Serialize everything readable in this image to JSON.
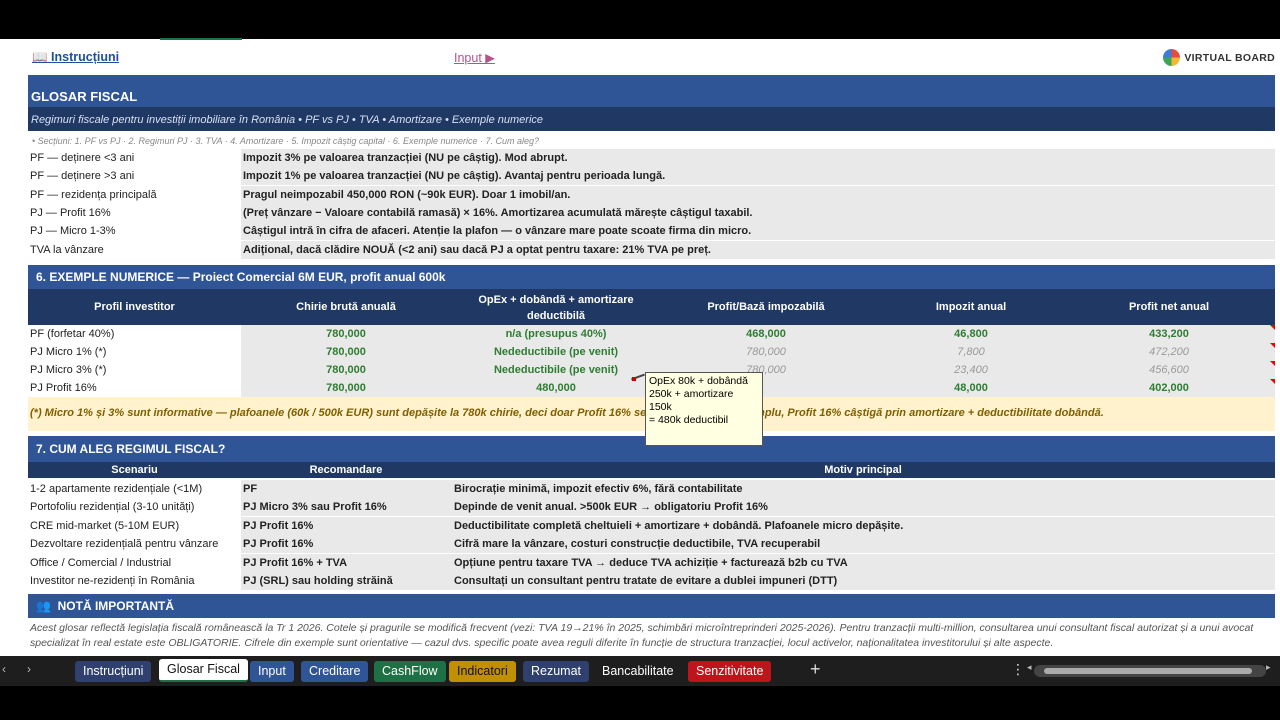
{
  "top": {
    "instructiuni_link": "Instrucțiuni",
    "input_link": "Input ▶",
    "logo_text": "VIRTUAL BOARD"
  },
  "glosar": {
    "title": "GLOSAR FISCAL",
    "subtitle": "Regimuri fiscale pentru investiții imobiliare în România  •  PF vs PJ  •  TVA  •  Amortizare  •  Exemple numerice",
    "sections": "•  Secțiuni:  1. PF vs PJ   ·   2. Regimuri PJ   ·   3. TVA   ·   4. Amortizare   ·   5. Impozit câștig capital   ·   6. Exemple numerice   ·   7. Cum aleg?"
  },
  "summary_rows": [
    {
      "label": "PF — deținere <3 ani",
      "text": "Impozit 3% pe valoarea tranzacției (NU pe câștig). Mod abrupt."
    },
    {
      "label": "PF — deținere >3 ani",
      "text": "Impozit 1% pe valoarea tranzacției (NU pe câștig). Avantaj pentru perioada lungă."
    },
    {
      "label": "PF — rezidența principală",
      "text": "Pragul neimpozabil 450,000 RON (~90k EUR). Doar 1 imobil/an."
    },
    {
      "label": "PJ — Profit 16%",
      "text": "(Preț vânzare − Valoare contabilă ramasă) × 16%. Amortizarea acumulată mărește câștigul taxabil."
    },
    {
      "label": "PJ — Micro 1-3%",
      "text": "Câștigul intră în cifra de afaceri. Atenție la plafon — o vânzare mare poate scoate firma din micro."
    },
    {
      "label": "TVA la vânzare",
      "text": "Adițional, dacă clădire NOUĂ (<2 ani) sau dacă PJ a optat pentru taxare: 21% TVA pe preț."
    }
  ],
  "exemple": {
    "title": "6. EXEMPLE NUMERICE — Proiect Comercial 6M EUR, profit anual 600k",
    "headers": [
      "Profil investitor",
      "Chirie brută anuală",
      "OpEx + dobândă + amortizare deductibilă",
      "Profit/Bază impozabilă",
      "Impozit anual",
      "Profit net anual"
    ],
    "rows": [
      {
        "profil": "PF (forfetar 40%)",
        "chirie": "780,000",
        "opex": "n/a (presupus 40%)",
        "baza": "468,000",
        "impozit": "46,800",
        "net": "433,200",
        "muted": false
      },
      {
        "profil": "PJ Micro 1%  (*)",
        "chirie": "780,000",
        "opex": "Nedeductibile (pe venit)",
        "baza": "780,000",
        "impozit": "7,800",
        "net": "472,200",
        "muted": true
      },
      {
        "profil": "PJ Micro 3%  (*)",
        "chirie": "780,000",
        "opex": "Nedeductibile (pe venit)",
        "baza": "780,000",
        "impozit": "23,400",
        "net": "456,600",
        "muted": true
      },
      {
        "profil": "PJ Profit 16%",
        "chirie": "780,000",
        "opex": "480,000",
        "baza": "",
        "impozit": "48,000",
        "net": "402,000",
        "muted": false
      }
    ],
    "note": "(*) Micro 1% și 3% sunt informative — plafoanele (60k / 500k EUR) sunt depășite la 780k chirie, deci doar Profit 16% se aplică efectiv. În exemplu, Profit 16% câștigă prin amortizare + deductibilitate dobândă.",
    "tooltip": [
      "OpEx 80k + dobândă",
      "250k + amortizare 150k",
      "= 480k deductibil"
    ]
  },
  "cum_aleg": {
    "title": "7. CUM ALEG REGIMUL FISCAL?",
    "headers": [
      "Scenariu",
      "Recomandare",
      "Motiv principal"
    ],
    "rows": [
      {
        "scenariu": "1-2 apartamente rezidențiale (<1M)",
        "rec": "PF",
        "motiv": "Birocrație minimă, impozit efectiv 6%, fără contabilitate"
      },
      {
        "scenariu": "Portofoliu rezidențial (3-10 unități)",
        "rec": "PJ Micro 3% sau Profit 16%",
        "motiv": "Depinde de venit anual. >500k EUR → obligatoriu Profit 16%"
      },
      {
        "scenariu": "CRE mid-market (5-10M EUR)",
        "rec": "PJ Profit 16%",
        "motiv": "Deductibilitate completă cheltuieli + amortizare + dobândă. Plafoanele micro depășite."
      },
      {
        "scenariu": "Dezvoltare rezidențială pentru vânzare",
        "rec": "PJ Profit 16%",
        "motiv": "Cifră mare la vânzare, costuri construcție deductibile, TVA recuperabil"
      },
      {
        "scenariu": "Office / Comercial / Industrial",
        "rec": "PJ Profit 16% + TVA",
        "motiv": "Opțiune pentru taxare TVA → deduce TVA achiziție + facturează b2b cu TVA"
      },
      {
        "scenariu": "Investitor ne-rezidenți în România",
        "rec": "PJ (SRL) sau holding străină",
        "motiv": "Consultați un consultant pentru tratate de evitare a dublei impuneri (DTT)"
      }
    ]
  },
  "nota": {
    "title": "NOTĂ IMPORTANTĂ",
    "text": "Acest glosar reflectă legislația fiscală românească la Tr 1 2026. Cotele și pragurile se modifică frecvent (vezi: TVA 19→21% în 2025, schimbări microîntreprinderi 2025-2026). Pentru tranzacții multi-million, consultarea unui consultant fiscal autorizat și a unui avocat specializat în real estate este OBLIGATORIE. Cifrele din exemple sunt orientative — cazul dvs. specific poate avea reguli diferite în funcție de structura tranzacției, locul activelor, naționalitatea investitorului și alte aspecte."
  },
  "tabs": [
    {
      "label": "Instrucțiuni",
      "bg": "#2f3f6e",
      "color": "#ffffff"
    },
    {
      "label": "Glosar Fiscal",
      "bg": "#ffffff",
      "color": "#111111"
    },
    {
      "label": "Input",
      "bg": "#2f5597",
      "color": "#ffffff"
    },
    {
      "label": "Creditare",
      "bg": "#2f5597",
      "color": "#ffffff"
    },
    {
      "label": "CashFlow",
      "bg": "#1e7145",
      "color": "#ffffff"
    },
    {
      "label": "Indicatori",
      "bg": "#c09000",
      "color": "#111111"
    },
    {
      "label": "Rezumat",
      "bg": "#2f3f6e",
      "color": "#ffffff"
    },
    {
      "label": "Bancabilitate",
      "bg": "#1e1e1e",
      "color": "#ffffff"
    },
    {
      "label": "Senzitivitate",
      "bg": "#c0141c",
      "color": "#ffffff"
    }
  ],
  "colors": {
    "header_blue": "#2f5597",
    "dark_navy": "#1f3864",
    "green_value": "#2e7d32",
    "note_yellow": "#fff2cc"
  }
}
